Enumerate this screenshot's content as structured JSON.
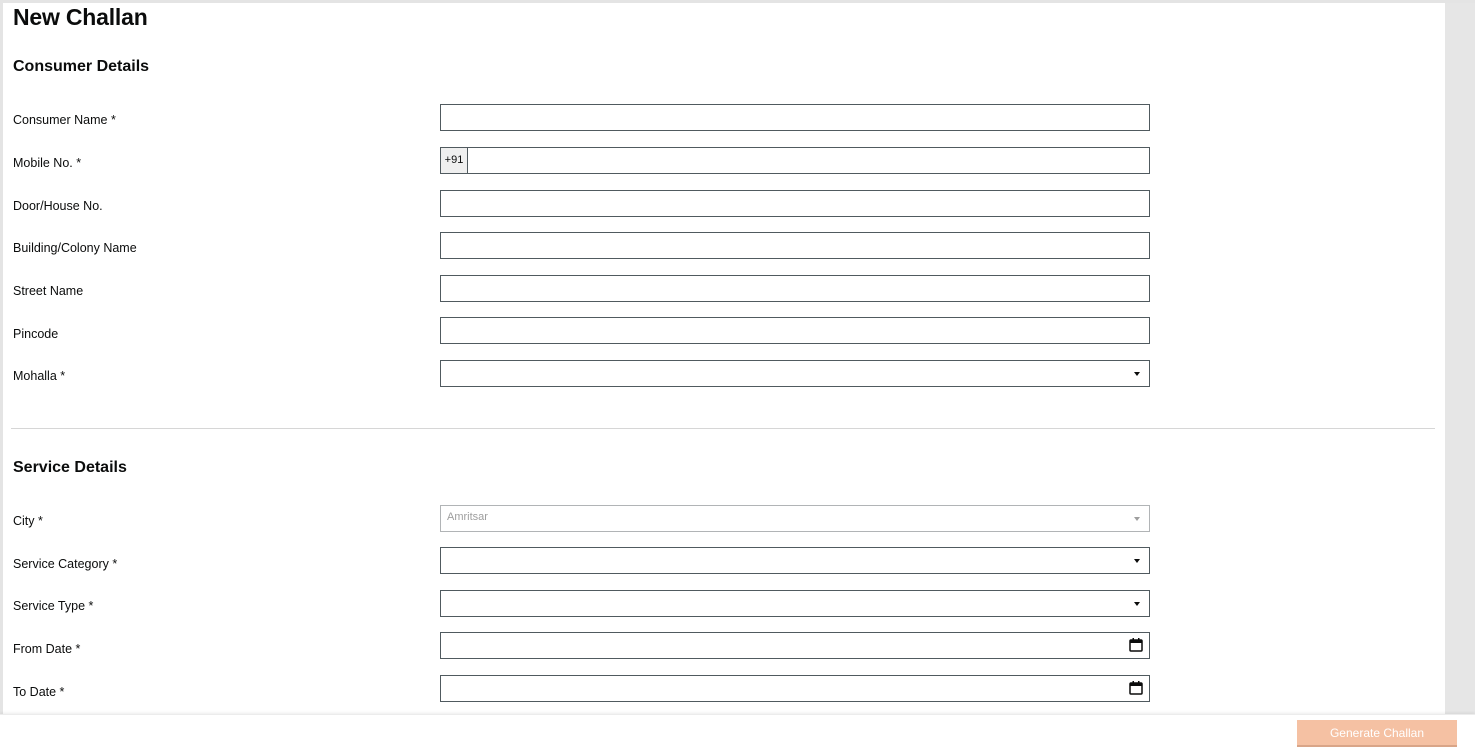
{
  "page": {
    "title": "New Challan"
  },
  "consumer": {
    "section_title": "Consumer Details",
    "fields": [
      {
        "label": "Consumer Name *",
        "value": ""
      },
      {
        "label": "Mobile No. *",
        "prefix": "+91",
        "value": ""
      },
      {
        "label": "Door/House No.",
        "value": ""
      },
      {
        "label": "Building/Colony Name",
        "value": ""
      },
      {
        "label": "Street Name",
        "value": ""
      },
      {
        "label": "Pincode",
        "value": ""
      },
      {
        "label": "Mohalla *",
        "value": ""
      }
    ]
  },
  "service": {
    "section_title": "Service Details",
    "fields": [
      {
        "label": "City *",
        "value": "Amritsar"
      },
      {
        "label": "Service Category *",
        "value": ""
      },
      {
        "label": "Service Type *",
        "value": ""
      },
      {
        "label": "From Date *",
        "value": ""
      },
      {
        "label": "To Date *",
        "value": ""
      }
    ]
  },
  "footer": {
    "generate_label": "Generate Challan",
    "generate_color": "#f5c1a3"
  },
  "icons": {
    "dropdown": "chevron-down-icon",
    "calendar": "calendar-icon"
  }
}
